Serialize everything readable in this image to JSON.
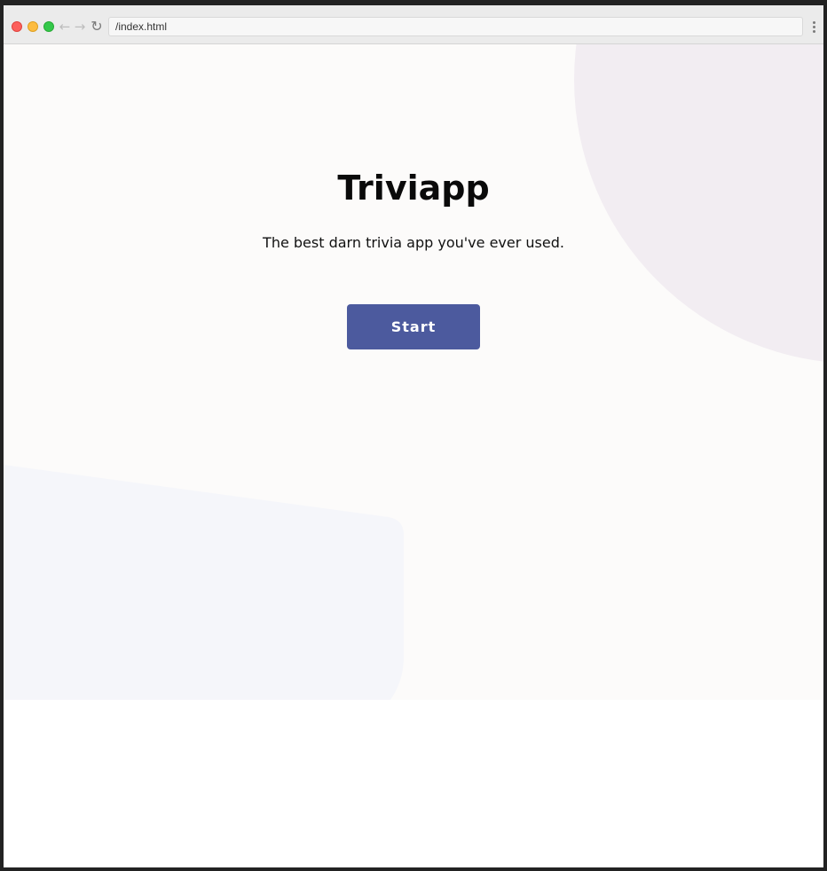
{
  "browser": {
    "address": "/index.html",
    "back_icon": "arrow-left-icon",
    "forward_icon": "arrow-right-icon",
    "reload_icon": "reload-icon",
    "menu_icon": "kebab-menu-icon"
  },
  "hero": {
    "title": "Triviapp",
    "subtitle": "The best darn trivia app you've ever used.",
    "start_label": "Start"
  },
  "colors": {
    "hero_background": "#fcfbfa",
    "blob_top": "#f2edf2",
    "blob_bottom": "#f5f6fa",
    "button": "#4c5a9e",
    "button_text": "#ffffff"
  }
}
